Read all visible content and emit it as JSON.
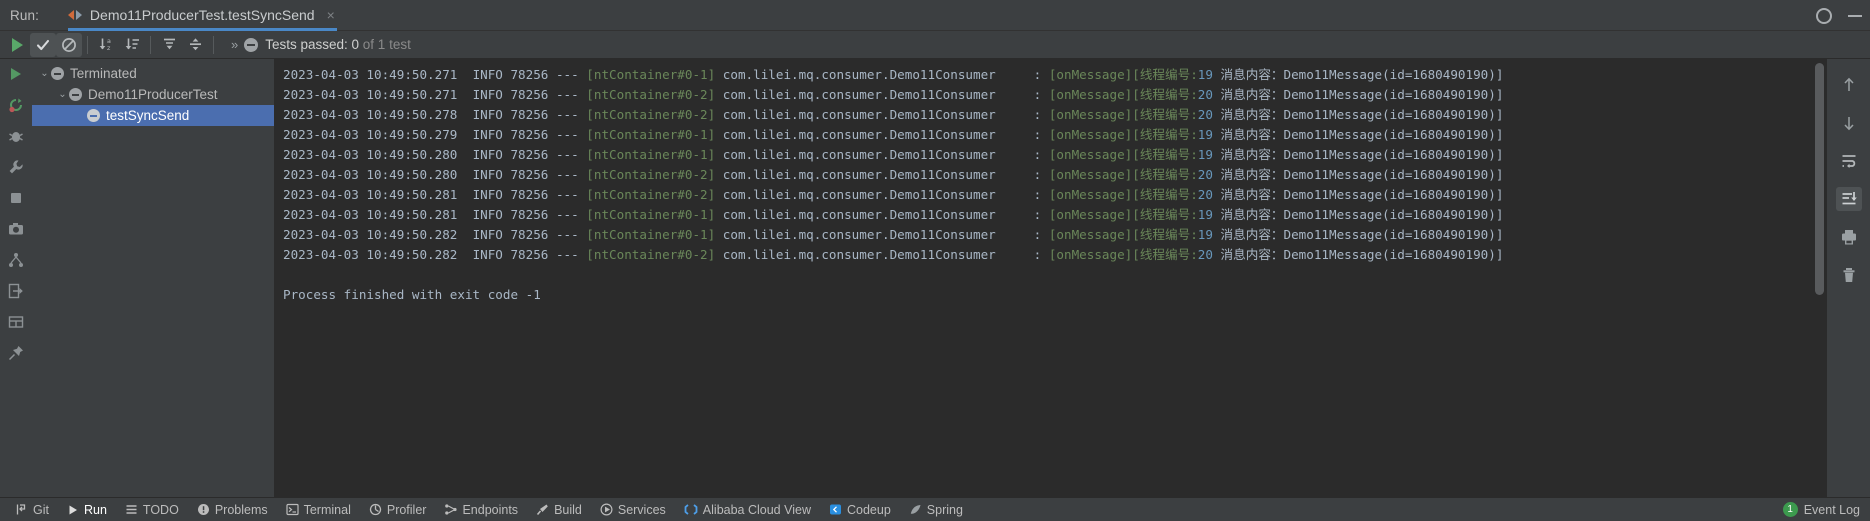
{
  "window": {
    "run_label": "Run:",
    "tab_title": "Demo11ProducerTest.testSyncSend",
    "close_glyph": "×",
    "settings_icon": "gear-icon",
    "minimize_icon": "minimize-icon"
  },
  "toolbar": {
    "rerun_tooltip": "Rerun",
    "buttons": [
      {
        "name": "rerun-tests-button",
        "icon": "play-icon"
      },
      {
        "name": "show-passed-toggle",
        "icon": "check-icon",
        "toggled": true
      },
      {
        "name": "show-ignored-toggle",
        "icon": "no-entry-icon",
        "toggled": true
      },
      {
        "name": "sort-alphabetically-button",
        "icon": "sort-alpha-icon"
      },
      {
        "name": "sort-by-duration-button",
        "icon": "sort-duration-icon"
      },
      {
        "name": "expand-all-button",
        "icon": "expand-all-icon"
      },
      {
        "name": "collapse-all-button",
        "icon": "collapse-all-icon"
      }
    ],
    "overflow_glyph": "»",
    "status": {
      "icon": "terminated-icon",
      "prefix": "Tests passed: ",
      "count": "0",
      "suffix": " of 1 test"
    }
  },
  "left_rail": [
    {
      "name": "rail-rerun-icon",
      "icon": "play-green-icon"
    },
    {
      "name": "rail-rerun-failed-icon",
      "icon": "rerun-failed-icon"
    },
    {
      "name": "rail-stop-icon",
      "icon": "bug-icon"
    },
    {
      "name": "rail-settings-icon",
      "icon": "wrench-icon"
    },
    {
      "name": "rail-stop-process-icon",
      "icon": "stop-square-icon"
    },
    {
      "name": "rail-screenshot-icon",
      "icon": "camera-icon"
    },
    {
      "name": "rail-threads-icon",
      "icon": "threads-icon"
    },
    {
      "name": "rail-import-icon",
      "icon": "import-icon"
    },
    {
      "name": "rail-layout-icon",
      "icon": "layout-icon"
    },
    {
      "name": "rail-pin-icon",
      "icon": "pin-icon"
    }
  ],
  "tree": {
    "nodes": [
      {
        "label": "Terminated",
        "level": 1,
        "expanded": true,
        "selected": false,
        "arrow": "⌄",
        "icon": "terminated-icon"
      },
      {
        "label": "Demo11ProducerTest",
        "level": 2,
        "expanded": true,
        "selected": false,
        "arrow": "⌄",
        "icon": "terminated-icon"
      },
      {
        "label": "testSyncSend",
        "level": 3,
        "expanded": false,
        "selected": true,
        "arrow": "",
        "icon": "terminated-icon"
      }
    ]
  },
  "console": {
    "lines": [
      {
        "date": "2023-04-03 10:49:50.271",
        "level": "INFO",
        "pid": "78256",
        "dash": "---",
        "thread": "[ntContainer#0-1]",
        "logger": "com.lilei.mq.consumer.Demo11Consumer",
        "sep": ":",
        "method": "[onMessage]",
        "tagcn": "[线程编号:",
        "tagnum": "19",
        "tagend": "",
        "bodycn": " 消息内容：",
        "payload": "Demo11Message(id=1680490190)]"
      },
      {
        "date": "2023-04-03 10:49:50.271",
        "level": "INFO",
        "pid": "78256",
        "dash": "---",
        "thread": "[ntContainer#0-2]",
        "logger": "com.lilei.mq.consumer.Demo11Consumer",
        "sep": ":",
        "method": "[onMessage]",
        "tagcn": "[线程编号:",
        "tagnum": "20",
        "tagend": "",
        "bodycn": " 消息内容：",
        "payload": "Demo11Message(id=1680490190)]"
      },
      {
        "date": "2023-04-03 10:49:50.278",
        "level": "INFO",
        "pid": "78256",
        "dash": "---",
        "thread": "[ntContainer#0-2]",
        "logger": "com.lilei.mq.consumer.Demo11Consumer",
        "sep": ":",
        "method": "[onMessage]",
        "tagcn": "[线程编号:",
        "tagnum": "20",
        "tagend": "",
        "bodycn": " 消息内容：",
        "payload": "Demo11Message(id=1680490190)]"
      },
      {
        "date": "2023-04-03 10:49:50.279",
        "level": "INFO",
        "pid": "78256",
        "dash": "---",
        "thread": "[ntContainer#0-1]",
        "logger": "com.lilei.mq.consumer.Demo11Consumer",
        "sep": ":",
        "method": "[onMessage]",
        "tagcn": "[线程编号:",
        "tagnum": "19",
        "tagend": "",
        "bodycn": " 消息内容：",
        "payload": "Demo11Message(id=1680490190)]"
      },
      {
        "date": "2023-04-03 10:49:50.280",
        "level": "INFO",
        "pid": "78256",
        "dash": "---",
        "thread": "[ntContainer#0-1]",
        "logger": "com.lilei.mq.consumer.Demo11Consumer",
        "sep": ":",
        "method": "[onMessage]",
        "tagcn": "[线程编号:",
        "tagnum": "19",
        "tagend": "",
        "bodycn": " 消息内容：",
        "payload": "Demo11Message(id=1680490190)]"
      },
      {
        "date": "2023-04-03 10:49:50.280",
        "level": "INFO",
        "pid": "78256",
        "dash": "---",
        "thread": "[ntContainer#0-2]",
        "logger": "com.lilei.mq.consumer.Demo11Consumer",
        "sep": ":",
        "method": "[onMessage]",
        "tagcn": "[线程编号:",
        "tagnum": "20",
        "tagend": "",
        "bodycn": " 消息内容：",
        "payload": "Demo11Message(id=1680490190)]"
      },
      {
        "date": "2023-04-03 10:49:50.281",
        "level": "INFO",
        "pid": "78256",
        "dash": "---",
        "thread": "[ntContainer#0-2]",
        "logger": "com.lilei.mq.consumer.Demo11Consumer",
        "sep": ":",
        "method": "[onMessage]",
        "tagcn": "[线程编号:",
        "tagnum": "20",
        "tagend": "",
        "bodycn": " 消息内容：",
        "payload": "Demo11Message(id=1680490190)]"
      },
      {
        "date": "2023-04-03 10:49:50.281",
        "level": "INFO",
        "pid": "78256",
        "dash": "---",
        "thread": "[ntContainer#0-1]",
        "logger": "com.lilei.mq.consumer.Demo11Consumer",
        "sep": ":",
        "method": "[onMessage]",
        "tagcn": "[线程编号:",
        "tagnum": "19",
        "tagend": "",
        "bodycn": " 消息内容：",
        "payload": "Demo11Message(id=1680490190)]"
      },
      {
        "date": "2023-04-03 10:49:50.282",
        "level": "INFO",
        "pid": "78256",
        "dash": "---",
        "thread": "[ntContainer#0-1]",
        "logger": "com.lilei.mq.consumer.Demo11Consumer",
        "sep": ":",
        "method": "[onMessage]",
        "tagcn": "[线程编号:",
        "tagnum": "19",
        "tagend": "",
        "bodycn": " 消息内容：",
        "payload": "Demo11Message(id=1680490190)]"
      },
      {
        "date": "2023-04-03 10:49:50.282",
        "level": "INFO",
        "pid": "78256",
        "dash": "---",
        "thread": "[ntContainer#0-2]",
        "logger": "com.lilei.mq.consumer.Demo11Consumer",
        "sep": ":",
        "method": "[onMessage]",
        "tagcn": "[线程编号:",
        "tagnum": "20",
        "tagend": "",
        "bodycn": " 消息内容：",
        "payload": "Demo11Message(id=1680490190)]"
      }
    ],
    "exit_line": "Process finished with exit code -1"
  },
  "right_rail": [
    {
      "name": "scroll-up-button",
      "icon": "arrow-up-icon"
    },
    {
      "name": "scroll-down-button",
      "icon": "arrow-down-icon"
    },
    {
      "name": "soft-wrap-button",
      "icon": "soft-wrap-icon"
    },
    {
      "name": "scroll-to-end-button",
      "icon": "scroll-to-end-icon",
      "toggled": true
    },
    {
      "name": "print-button",
      "icon": "printer-icon"
    },
    {
      "name": "clear-all-button",
      "icon": "trash-icon"
    }
  ],
  "statusbar": {
    "items": [
      {
        "name": "statusbar-git",
        "label": "Git",
        "icon": "git-branch-icon",
        "active": false
      },
      {
        "name": "statusbar-run",
        "label": "Run",
        "icon": "play-icon",
        "active": true
      },
      {
        "name": "statusbar-todo",
        "label": "TODO",
        "icon": "list-icon",
        "active": false
      },
      {
        "name": "statusbar-problems",
        "label": "Problems",
        "icon": "warning-icon",
        "active": false
      },
      {
        "name": "statusbar-terminal",
        "label": "Terminal",
        "icon": "terminal-icon",
        "active": false
      },
      {
        "name": "statusbar-profiler",
        "label": "Profiler",
        "icon": "profiler-icon",
        "active": false
      },
      {
        "name": "statusbar-endpoints",
        "label": "Endpoints",
        "icon": "endpoints-icon",
        "active": false
      },
      {
        "name": "statusbar-build",
        "label": "Build",
        "icon": "hammer-icon",
        "active": false
      },
      {
        "name": "statusbar-services",
        "label": "Services",
        "icon": "services-icon",
        "active": false
      },
      {
        "name": "statusbar-alibaba-cloud-view",
        "label": "Alibaba Cloud View",
        "icon": "cloud-icon",
        "active": false
      },
      {
        "name": "statusbar-codeup",
        "label": "Codeup",
        "icon": "codeup-icon",
        "active": false
      },
      {
        "name": "statusbar-spring",
        "label": "Spring",
        "icon": "spring-leaf-icon",
        "active": false
      }
    ],
    "event_log": {
      "label": "Event Log",
      "count": "1"
    }
  }
}
